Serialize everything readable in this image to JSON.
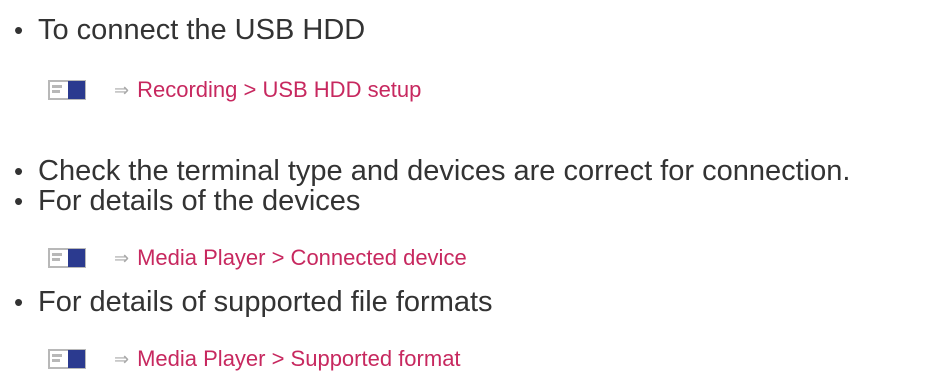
{
  "items": [
    {
      "text": "To connect the USB HDD",
      "link": {
        "arrow": "⇒",
        "path": "Recording > USB HDD setup",
        "icon": "menu-screen-icon"
      }
    },
    {
      "text": "Check the terminal type and devices are correct for connection."
    },
    {
      "text": "For details of the devices",
      "link": {
        "arrow": "⇒",
        "path": "Media Player > Connected device",
        "icon": "menu-screen-icon"
      }
    },
    {
      "text": "For details of supported file formats",
      "link": {
        "arrow": "⇒",
        "path": "Media Player > Supported format",
        "icon": "menu-screen-icon"
      }
    }
  ],
  "colors": {
    "text": "#333333",
    "link": "#c7285f",
    "arrow": "#a9a9a9",
    "icon_gray": "#b8b8b8",
    "icon_blue": "#2b3a8f"
  }
}
